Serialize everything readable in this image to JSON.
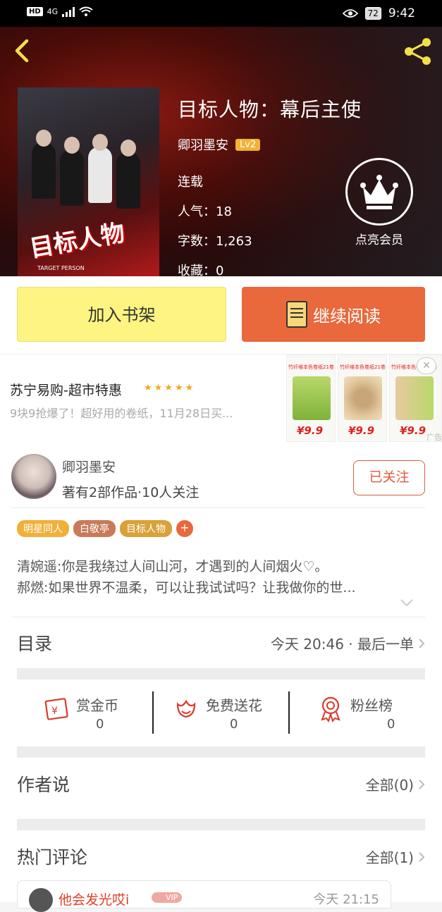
{
  "status": {
    "network": "4G",
    "hd": "HD",
    "battery": "72",
    "time": "9:42"
  },
  "book": {
    "title": "目标人物：幕后主使",
    "author": "卿羽墨安",
    "level": "Lv2",
    "status": "连载",
    "popularity": "人气：18",
    "words": "字数：1,263",
    "favorites": "收藏：0",
    "cover_text": "目标人物",
    "cover_sub": "TARGET PERSON"
  },
  "vip": {
    "label": "点亮会员"
  },
  "actions": {
    "add_shelf": "加入书架",
    "continue_read": "继续阅读"
  },
  "ad": {
    "title": "苏宁易购-超市特惠",
    "stars": "★★★★★",
    "desc": "9块9抢爆了！超好用的卷纸，11月28日买...",
    "product_caption": "竹纤维本色卷纸21卷",
    "price": "¥9.9",
    "close": "✕",
    "tag": "广告"
  },
  "author_card": {
    "name": "卿羽墨安",
    "stats": "著有2部作品·10人关注",
    "follow": "已关注"
  },
  "tags": [
    {
      "label": "明星同人",
      "color": "#f0b03a"
    },
    {
      "label": "白敬亭",
      "color": "#c97a5a"
    },
    {
      "label": "目标人物",
      "color": "#d8a13a"
    }
  ],
  "tag_add": "+",
  "synopsis": {
    "line1": "清婉遥:你是我绕过人间山河，才遇到的人间烟火♡。",
    "line2": "郝燃:如果世界不温柔，可以让我试试吗？让我做你的世..."
  },
  "catalog": {
    "title": "目录",
    "latest": "今天 20:46 · 最后一单"
  },
  "gifts": [
    {
      "name": "赏金币",
      "count": "0",
      "icon": "red-envelope-icon"
    },
    {
      "name": "免费送花",
      "count": "0",
      "icon": "flower-icon"
    },
    {
      "name": "粉丝榜",
      "count": "0",
      "icon": "medal-icon"
    }
  ],
  "author_says": {
    "title": "作者说",
    "all": "全部(0)"
  },
  "hot_comments": {
    "title": "热门评论",
    "all": "全部(1)"
  },
  "comment": {
    "user": "他会发光哎i",
    "badge": "VIP",
    "time": "今天 21:15"
  }
}
